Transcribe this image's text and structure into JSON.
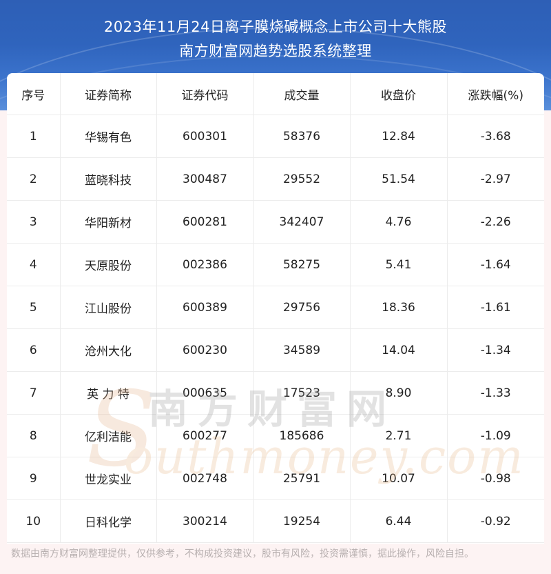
{
  "header": {
    "title_line1": "2023年11月24日离子膜烧碱概念上市公司十大熊股",
    "title_line2": "南方财富网趋势选股系统整理"
  },
  "table": {
    "columns": [
      "序号",
      "证券简称",
      "证券代码",
      "成交量",
      "收盘价",
      "涨跌幅(%)"
    ],
    "rows": [
      [
        "1",
        "华锡有色",
        "600301",
        "58376",
        "12.84",
        "-3.68"
      ],
      [
        "2",
        "蓝晓科技",
        "300487",
        "29552",
        "51.54",
        "-2.97"
      ],
      [
        "3",
        "华阳新材",
        "600281",
        "342407",
        "4.76",
        "-2.26"
      ],
      [
        "4",
        "天原股份",
        "002386",
        "58275",
        "5.41",
        "-1.64"
      ],
      [
        "5",
        "江山股份",
        "600389",
        "29756",
        "18.36",
        "-1.61"
      ],
      [
        "6",
        "沧州大化",
        "600230",
        "34589",
        "14.04",
        "-1.34"
      ],
      [
        "7",
        "英 力 特",
        "000635",
        "17523",
        "8.90",
        "-1.33"
      ],
      [
        "8",
        "亿利洁能",
        "600277",
        "185686",
        "2.71",
        "-1.09"
      ],
      [
        "9",
        "世龙实业",
        "002748",
        "25791",
        "10.07",
        "-0.98"
      ],
      [
        "10",
        "日科化学",
        "300214",
        "19254",
        "6.44",
        "-0.92"
      ]
    ]
  },
  "watermark": {
    "cn": "南方财富网",
    "en": "outhmoney.com",
    "s_glyph": "S"
  },
  "footer": {
    "disclaimer": "数据由南方财富网整理提供，仅供参考，不构成投资建议，股市有风险，投资需谨慎，据此操作，风险自担。"
  }
}
